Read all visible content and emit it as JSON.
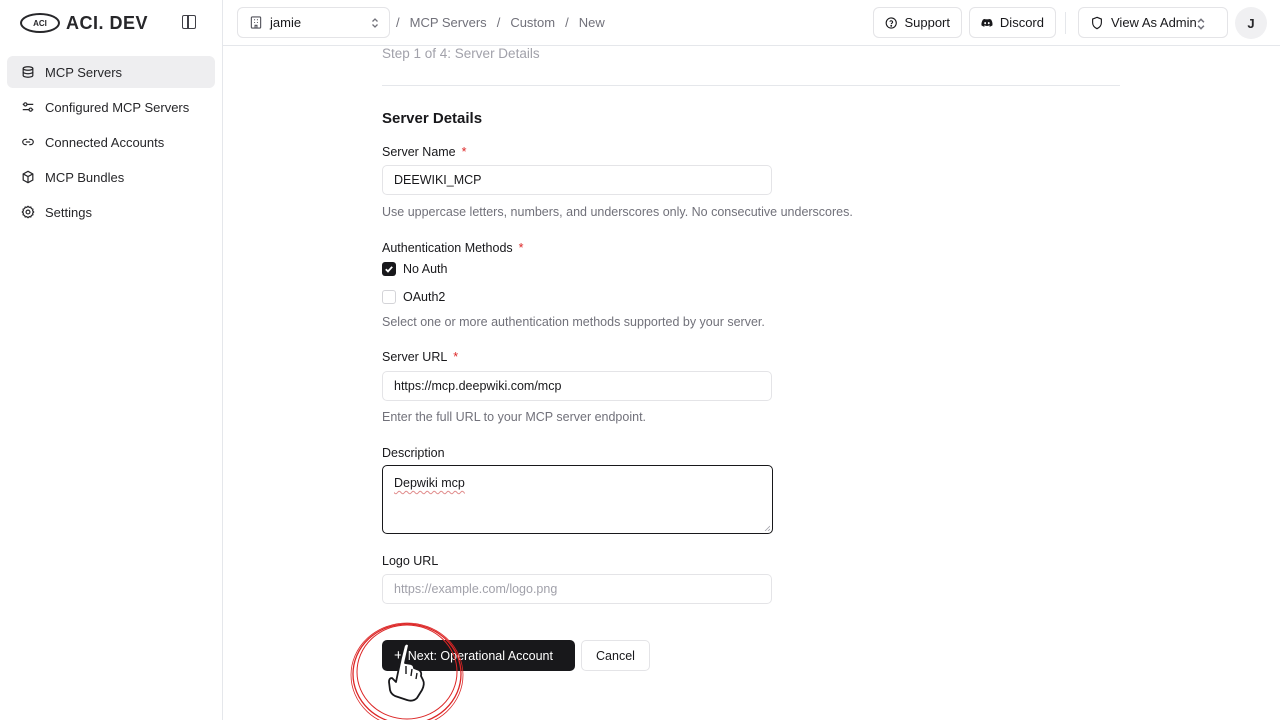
{
  "brand": {
    "badge": "ACI",
    "name": "ACI. DEV"
  },
  "sidebar": {
    "items": [
      {
        "label": "MCP Servers",
        "icon": "database-icon",
        "active": true
      },
      {
        "label": "Configured MCP Servers",
        "icon": "sliders-icon",
        "active": false
      },
      {
        "label": "Connected Accounts",
        "icon": "link-icon",
        "active": false
      },
      {
        "label": "MCP Bundles",
        "icon": "package-icon",
        "active": false
      },
      {
        "label": "Settings",
        "icon": "gear-icon",
        "active": false
      }
    ]
  },
  "header": {
    "org": "jamie",
    "breadcrumb": [
      "MCP Servers",
      "Custom",
      "New"
    ],
    "support_label": "Support",
    "discord_label": "Discord",
    "role_label": "View As Admin",
    "avatar_initial": "J"
  },
  "form": {
    "step": "Step 1 of 4: Server Details",
    "section_title": "Server Details",
    "server_name": {
      "label": "Server Name",
      "required": "*",
      "value": "DEEWIKI_MCP",
      "help": "Use uppercase letters, numbers, and underscores only. No consecutive underscores."
    },
    "auth": {
      "label": "Authentication Methods",
      "required": "*",
      "options": [
        {
          "label": "No Auth",
          "checked": true
        },
        {
          "label": "OAuth2",
          "checked": false
        }
      ],
      "help": "Select one or more authentication methods supported by your server."
    },
    "server_url": {
      "label": "Server URL",
      "required": "*",
      "value": "https://mcp.deepwiki.com/mcp",
      "help": "Enter the full URL to your MCP server endpoint."
    },
    "description": {
      "label": "Description",
      "value": "Depwiki mcp"
    },
    "logo_url": {
      "label": "Logo URL",
      "placeholder": "https://example.com/logo.png"
    },
    "next_label": "Next: Operational Account",
    "cancel_label": "Cancel"
  },
  "colors": {
    "primary": "#18181b",
    "required": "#dc2626",
    "muted": "#71717a",
    "click_highlight": "#dc2626"
  }
}
